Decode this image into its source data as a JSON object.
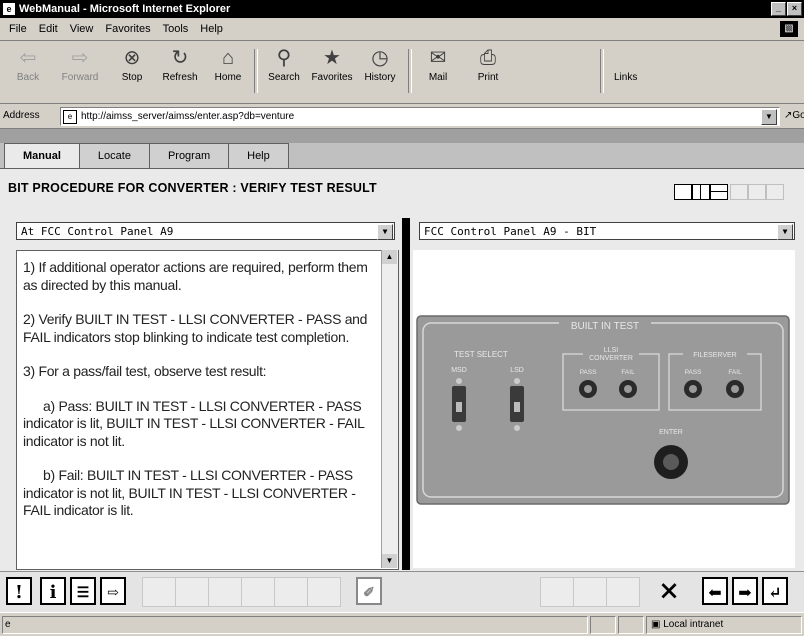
{
  "window": {
    "title": "WebManual - Microsoft Internet Explorer",
    "controls": [
      "_",
      "×"
    ]
  },
  "menu": [
    "File",
    "Edit",
    "View",
    "Favorites",
    "Tools",
    "Help"
  ],
  "toolbar": {
    "buttons": [
      {
        "label": "Back",
        "icon": "back-arrow-icon"
      },
      {
        "label": "Forward",
        "icon": "forward-arrow-icon"
      },
      {
        "label": "Stop",
        "icon": "stop-icon"
      },
      {
        "label": "Refresh",
        "icon": "refresh-icon"
      },
      {
        "label": "Home",
        "icon": "home-icon"
      },
      {
        "label": "Search",
        "icon": "search-icon"
      },
      {
        "label": "Favorites",
        "icon": "favorites-icon"
      },
      {
        "label": "History",
        "icon": "history-icon"
      },
      {
        "label": "Mail",
        "icon": "mail-icon"
      },
      {
        "label": "Print",
        "icon": "print-icon"
      }
    ],
    "links_label": "Links"
  },
  "address": {
    "label": "Address",
    "url": "http://aimss_server/aimss/enter.asp?db=venture",
    "go_label": "Go"
  },
  "app": {
    "tabs": [
      "Manual",
      "Locate",
      "Program",
      "Help"
    ],
    "active_tab": "Manual",
    "procedure_title": "BIT PROCEDURE FOR CONVERTER : VERIFY TEST RESULT",
    "left_select": "At FCC Control Panel A9",
    "right_select": "FCC Control Panel A9 - BIT",
    "steps": [
      "1) If additional operator actions are required, perform them as directed by this manual.",
      "2) Verify BUILT IN TEST - LLSI CONVERTER - PASS and FAIL indicators stop blinking to indicate test completion.",
      "3) For a pass/fail test, observe test result:",
      "a) Pass: BUILT IN TEST - LLSI CONVERTER - PASS indicator is lit, BUILT IN TEST - LLSI CONVERTER - FAIL indicator is not lit.",
      "b) Fail: BUILT IN TEST - LLSI CONVERTER - PASS indicator is not lit, BUILT IN TEST - LLSI CONVERTER - FAIL indicator is lit."
    ],
    "panel": {
      "title": "BUILT IN TEST",
      "test_select": "TEST SELECT",
      "switches": [
        "MSD",
        "LSD"
      ],
      "converter": "LLSI CONVERTER",
      "fileserver": "FILESERVER",
      "pass": "PASS",
      "fail": "FAIL",
      "enter": "ENTER"
    },
    "bottom_buttons": {
      "warning": "!",
      "info": "i",
      "close": "×"
    }
  },
  "status": {
    "zone": "Local intranet"
  }
}
